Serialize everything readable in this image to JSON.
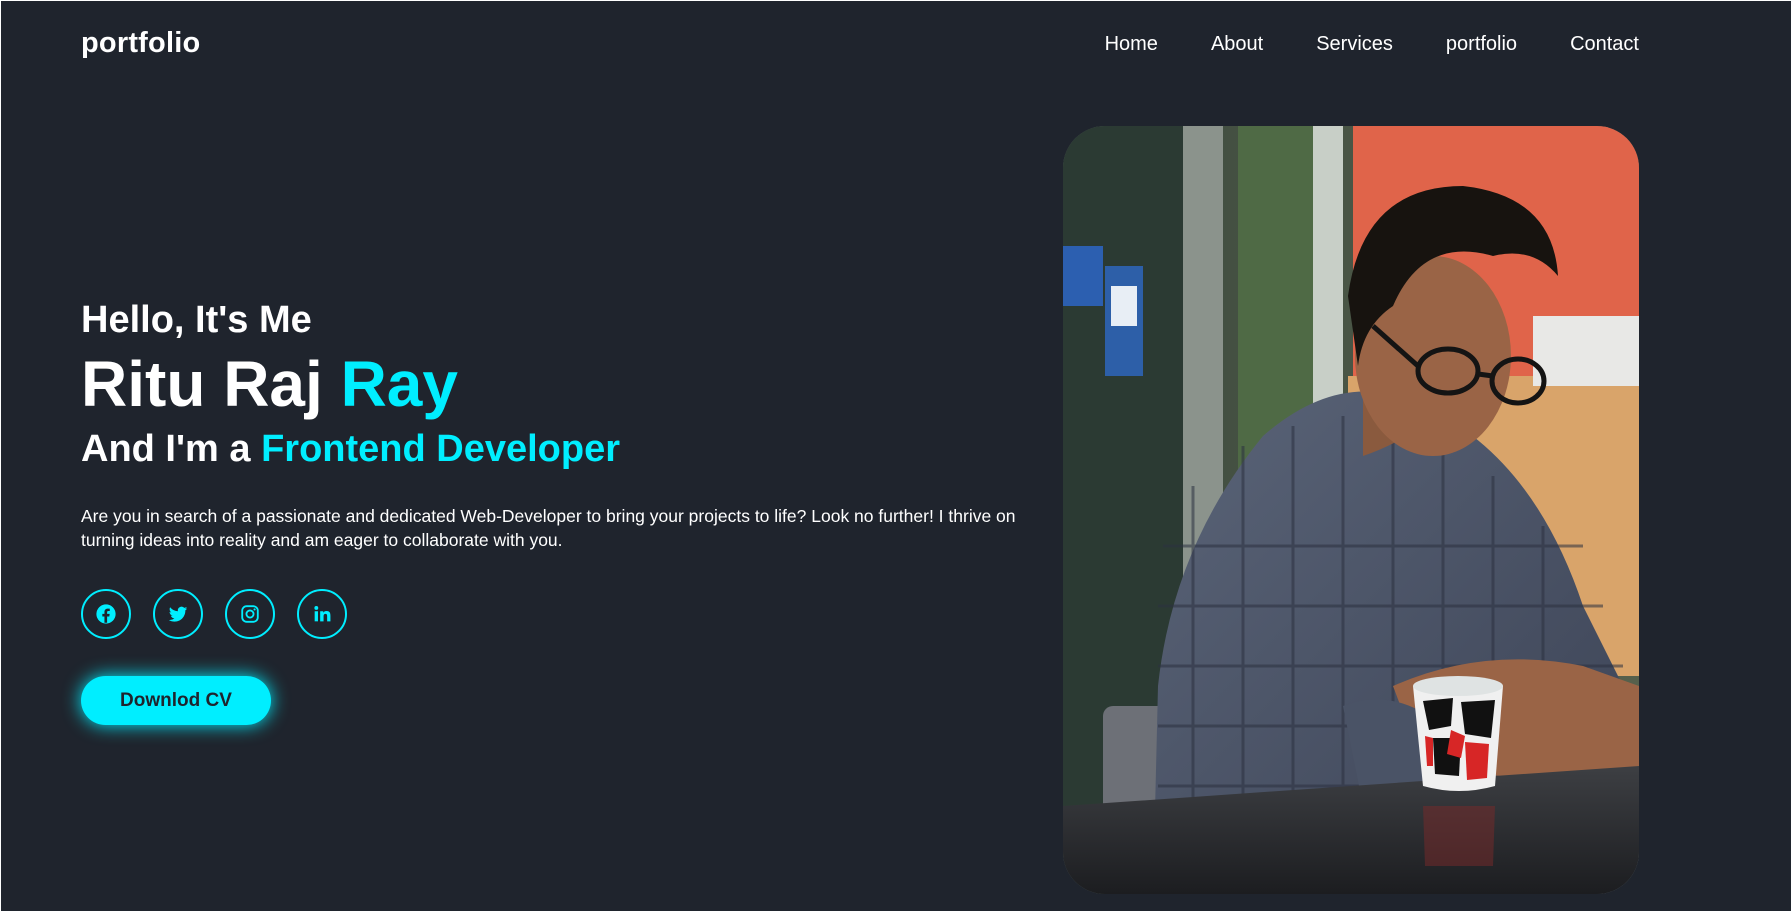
{
  "header": {
    "logo": "portfolio",
    "nav": [
      "Home",
      "About",
      "Services",
      "portfolio",
      "Contact"
    ]
  },
  "hero": {
    "greeting": "Hello, It's Me",
    "name_first": "Ritu Raj",
    "name_last": "Ray",
    "role_prefix": "And I'm a",
    "role": "Frontend Developer",
    "description": "Are you in search of a passionate and dedicated Web-Developer to bring your projects to life? Look no further! I thrive on turning ideas into reality and am eager to collaborate with you.",
    "socials": [
      "facebook-icon",
      "twitter-icon",
      "instagram-icon",
      "linkedin-icon"
    ],
    "cv_button": "Downlod CV"
  },
  "colors": {
    "background": "#1f242d",
    "accent": "#00eeff",
    "text": "#ffffff"
  }
}
